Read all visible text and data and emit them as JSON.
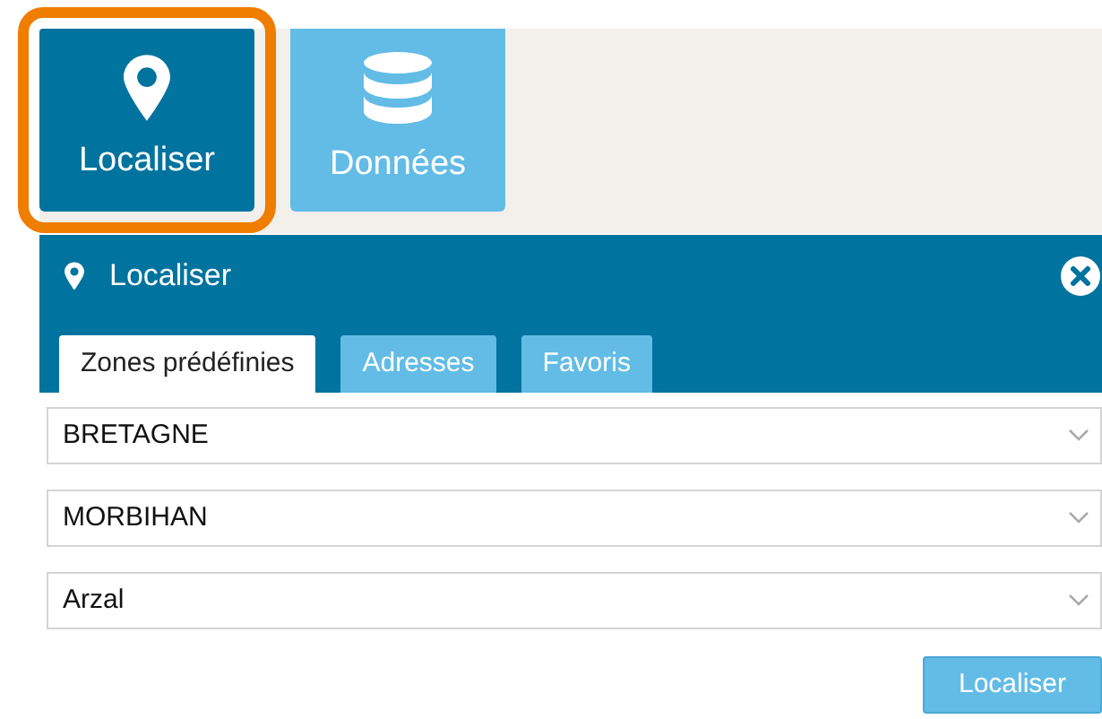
{
  "toolbar": [
    {
      "label": "Localiser",
      "kind": "pin",
      "selected": true
    },
    {
      "label": "Données",
      "kind": "database",
      "selected": false
    }
  ],
  "panel": {
    "title": "Localiser",
    "tabs": [
      {
        "label": "Zones prédéfinies",
        "selected": true
      },
      {
        "label": "Adresses",
        "selected": false
      },
      {
        "label": "Favoris",
        "selected": false
      }
    ],
    "selects": [
      {
        "value": "BRETAGNE"
      },
      {
        "value": "MORBIHAN"
      },
      {
        "value": "Arzal"
      }
    ],
    "button": "Localiser"
  }
}
